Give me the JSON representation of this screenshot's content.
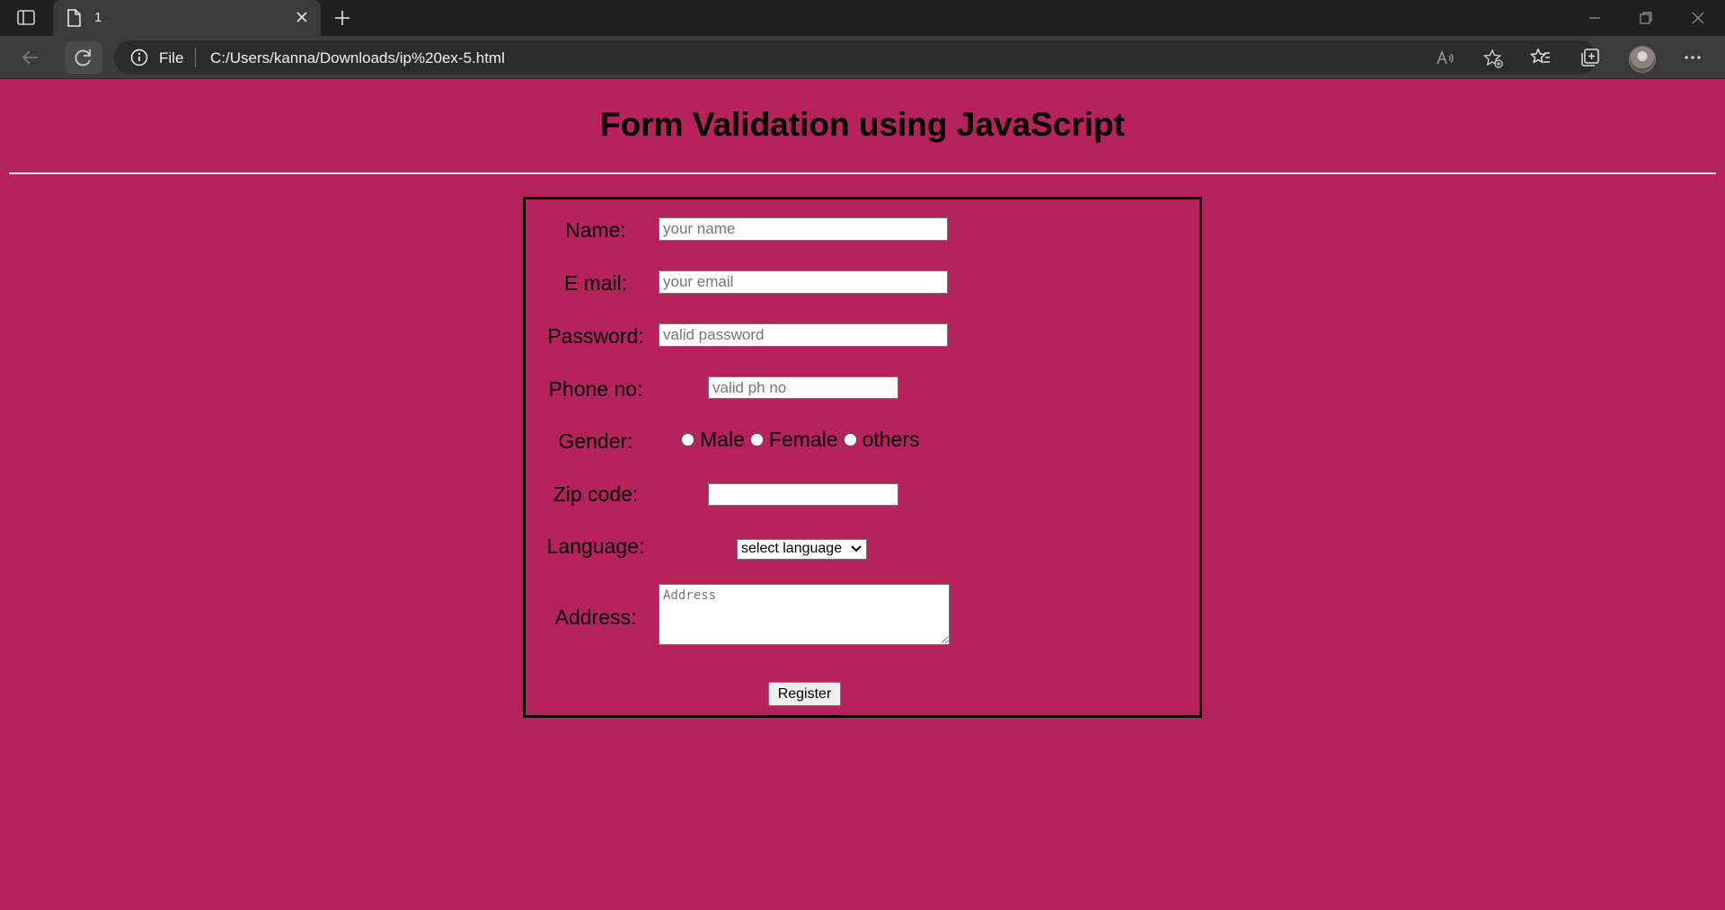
{
  "browser": {
    "tab_title": "1",
    "url_scheme": "File",
    "url": "C:/Users/kanna/Downloads/ip%20ex-5.html"
  },
  "page": {
    "title": "Form Validation using JavaScript"
  },
  "form": {
    "name_label": "Name:",
    "name_placeholder": "your name",
    "email_label": "E mail:",
    "email_placeholder": "your email",
    "password_label": "Password:",
    "password_placeholder": "valid password",
    "phone_label": "Phone no:",
    "phone_placeholder": "valid ph no",
    "gender_label": "Gender:",
    "gender_options": [
      "Male",
      "Female",
      "others"
    ],
    "zip_label": "Zip code:",
    "language_label": "Language:",
    "language_selected": "select language",
    "address_label": "Address:",
    "address_placeholder": "Address",
    "register_label": "Register"
  },
  "colors": {
    "page_background": "#b5225c",
    "chrome_dark": "#202020",
    "chrome_bar": "#3b3b3b"
  }
}
